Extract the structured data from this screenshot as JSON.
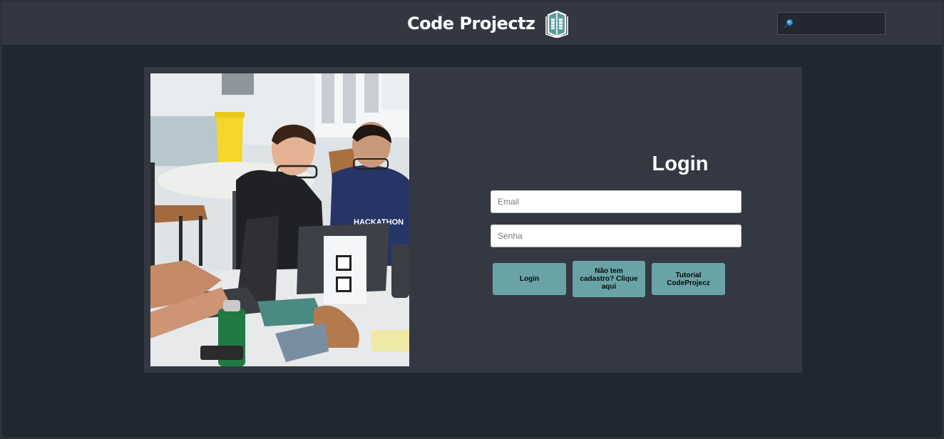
{
  "header": {
    "brand": "Code Projectz",
    "logo_icon": "book-logo-icon",
    "search": {
      "icon": "magnifier-icon",
      "value": "",
      "placeholder": ""
    }
  },
  "photo": {
    "description_icon": "hackathon-photo"
  },
  "login": {
    "title": "Login",
    "email_placeholder": "Email",
    "password_placeholder": "Senha",
    "buttons": {
      "login": "Login",
      "signup": "Não tem cadastro? Clique aqui",
      "tutorial": "Tutorial CodeProjecz"
    }
  },
  "colors": {
    "background": "#212731",
    "header": "#333742",
    "card": "#343842",
    "button": "#6aa3a6"
  }
}
